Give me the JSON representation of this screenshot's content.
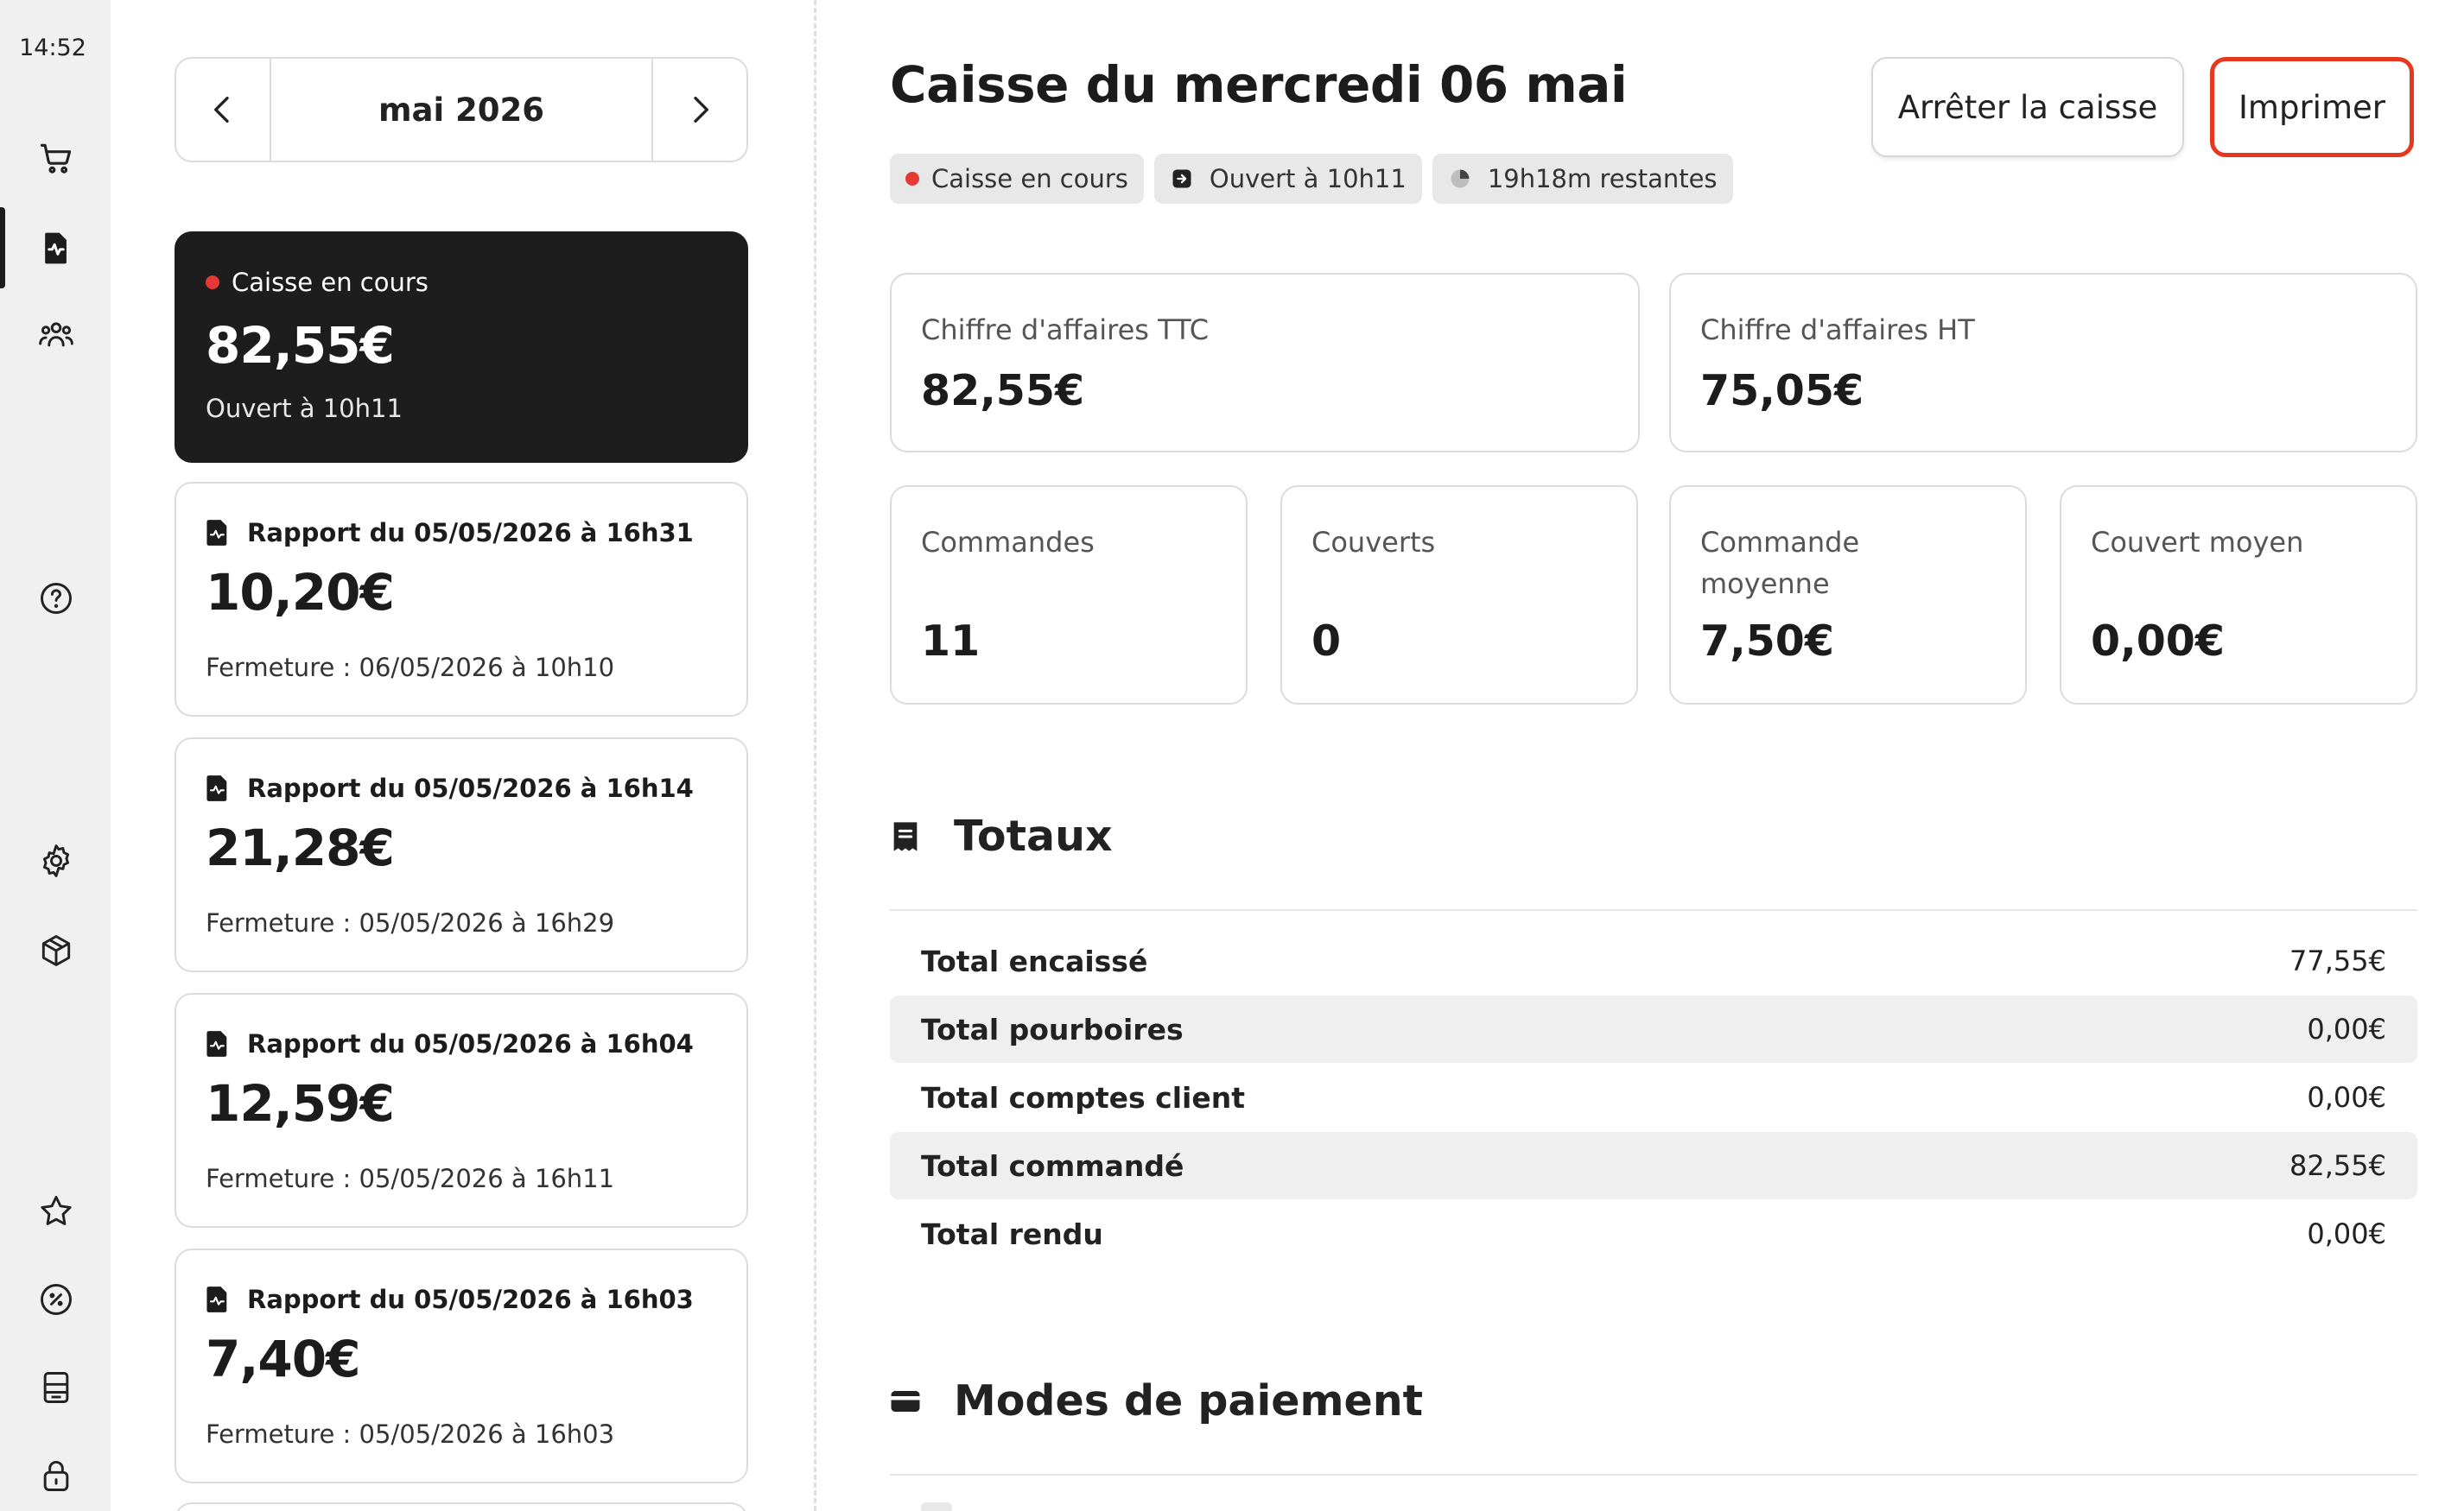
{
  "rail": {
    "time": "14:52",
    "icons": [
      "cart-icon",
      "report-icon",
      "users-icon",
      "help-icon",
      "settings-icon",
      "box-icon",
      "star-icon",
      "discount-icon",
      "printer-icon",
      "lock-icon"
    ]
  },
  "month_nav": {
    "label": "mai 2026"
  },
  "reports": [
    {
      "status": "Caisse en cours",
      "amount": "82,55€",
      "subtitle": "Ouvert à 10h11",
      "active": true
    },
    {
      "title": "Rapport du 05/05/2026 à 16h31",
      "amount": "10,20€",
      "subtitle": "Fermeture : 06/05/2026 à 10h10"
    },
    {
      "title": "Rapport du 05/05/2026 à 16h14",
      "amount": "21,28€",
      "subtitle": "Fermeture : 05/05/2026 à 16h29"
    },
    {
      "title": "Rapport du 05/05/2026 à 16h04",
      "amount": "12,59€",
      "subtitle": "Fermeture : 05/05/2026 à 16h11"
    },
    {
      "title": "Rapport du 05/05/2026 à 16h03",
      "amount": "7,40€",
      "subtitle": "Fermeture : 05/05/2026 à 16h03"
    }
  ],
  "header": {
    "title": "Caisse du mercredi 06 mai",
    "stop_label": "Arrêter la caisse",
    "print_label": "Imprimer"
  },
  "badges": {
    "status": "Caisse en cours",
    "opened": "Ouvert à 10h11",
    "remaining": "19h18m restantes"
  },
  "stats": {
    "ca_ttc": {
      "label": "Chiffre d'affaires TTC",
      "value": "82,55€"
    },
    "ca_ht": {
      "label": "Chiffre d'affaires HT",
      "value": "75,05€"
    },
    "commandes": {
      "label": "Commandes",
      "value": "11"
    },
    "couverts": {
      "label": "Couverts",
      "value": "0"
    },
    "commande_moyenne": {
      "label": "Commande moyenne",
      "value": "7,50€"
    },
    "couvert_moyen": {
      "label": "Couvert moyen",
      "value": "0,00€"
    }
  },
  "totals": {
    "heading": "Totaux",
    "rows": [
      {
        "label": "Total encaissé",
        "value": "77,55€"
      },
      {
        "label": "Total pourboires",
        "value": "0,00€"
      },
      {
        "label": "Total comptes client",
        "value": "0,00€"
      },
      {
        "label": "Total commandé",
        "value": "82,55€"
      },
      {
        "label": "Total rendu",
        "value": "0,00€"
      }
    ]
  },
  "payments": {
    "heading": "Modes de paiement"
  },
  "colors": {
    "accent": "#e5391f",
    "live_dot": "#e53935",
    "dark_card": "#1d1d1d"
  }
}
